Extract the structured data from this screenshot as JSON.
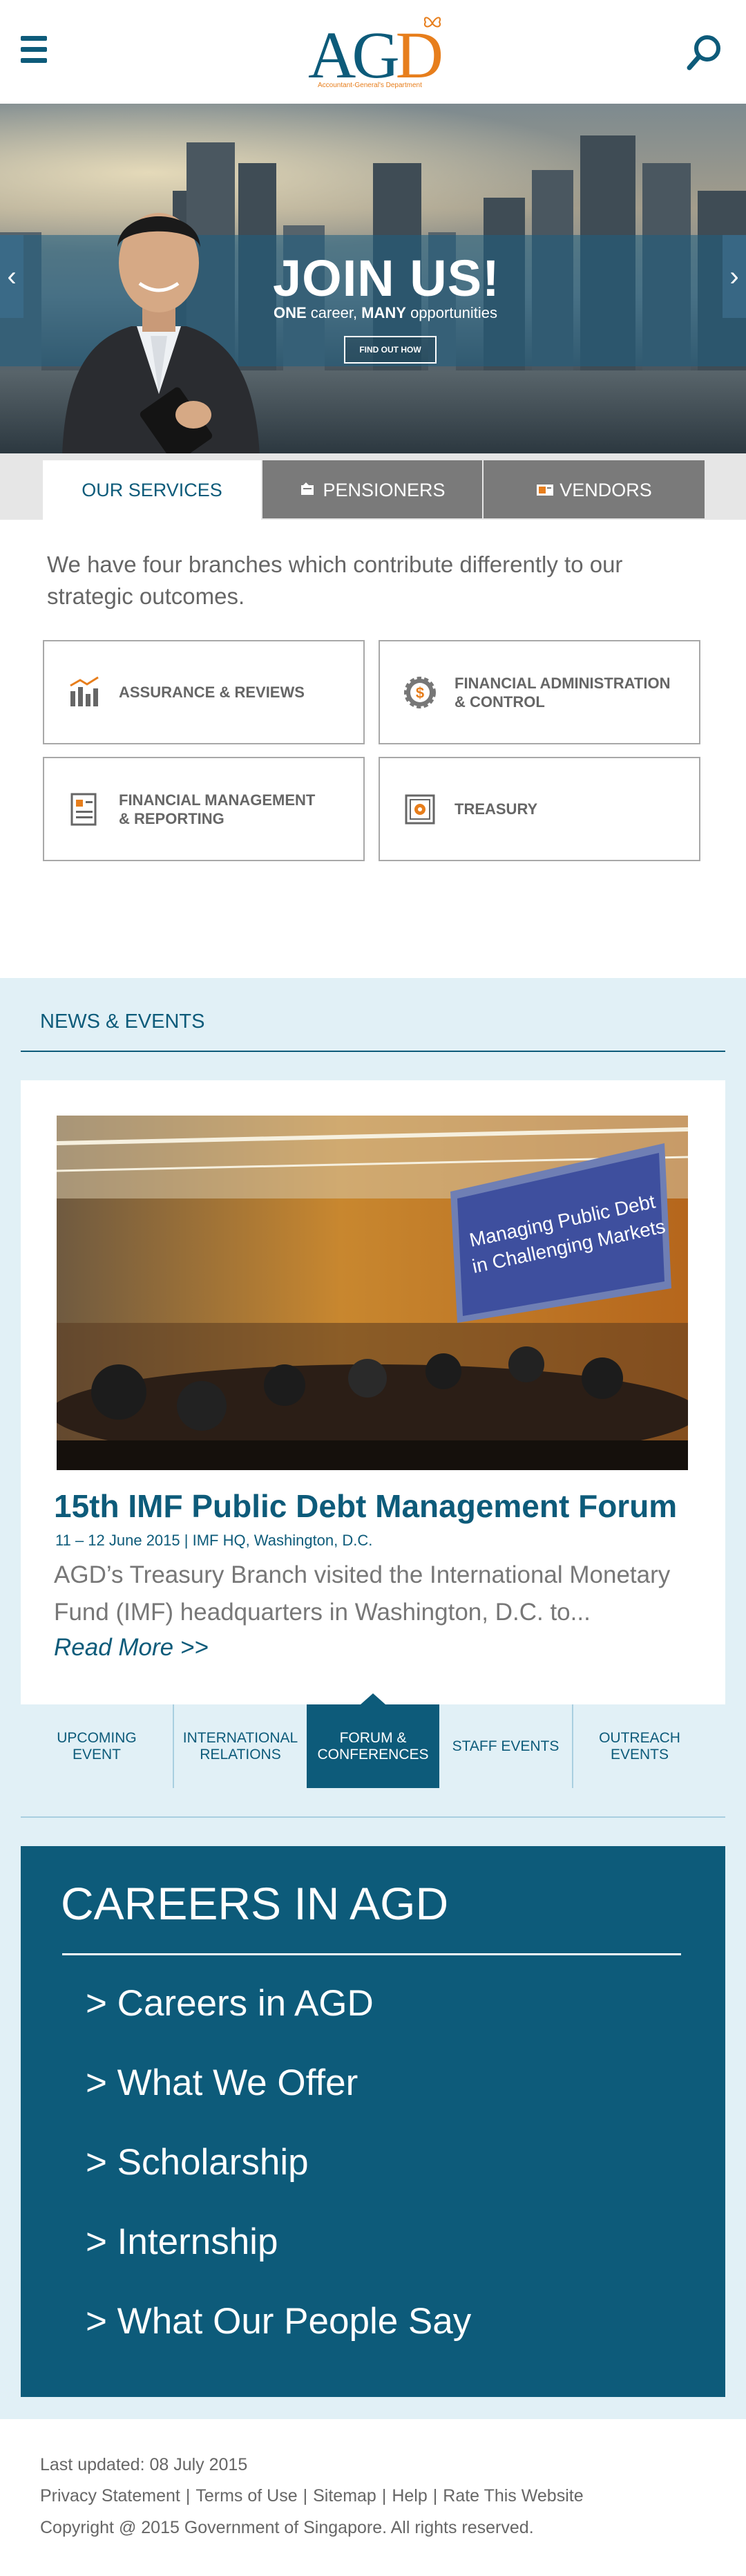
{
  "header": {
    "logo_text": "AGD",
    "logo_tagline": "Accountant-General's Department"
  },
  "hero": {
    "title": "JOIN US!",
    "subtitle_parts": [
      "ONE",
      " career, ",
      "MANY",
      " opportunities"
    ],
    "cta_label": "FIND OUT HOW",
    "prev_label": "‹",
    "next_label": "›"
  },
  "tabs": [
    {
      "label": "OUR SERVICES",
      "active": true
    },
    {
      "label": "PENSIONERS",
      "active": false
    },
    {
      "label": "VENDORS",
      "active": false
    }
  ],
  "services": {
    "intro": "We have four branches which contribute differently to our strategic outcomes.",
    "cards": [
      {
        "line1": "ASSURANCE & REVIEWS",
        "line2": "",
        "icon": "bar-chart-icon"
      },
      {
        "line1": "FINANCIAL ADMINISTRATION",
        "line2": "& CONTROL",
        "icon": "gear-dollar-icon"
      },
      {
        "line1": "FINANCIAL MANAGEMENT",
        "line2": "& REPORTING",
        "icon": "report-icon"
      },
      {
        "line1": "TREASURY",
        "line2": "",
        "icon": "safe-icon"
      }
    ]
  },
  "news": {
    "header": "NEWS & EVENTS",
    "photo_screen_text": [
      "Managing Public Debt",
      "in Challenging Markets"
    ],
    "title": "15th IMF Public Debt Management Forum",
    "meta": "11 – 12 June 2015 | IMF HQ, Washington, D.C.",
    "body": "AGD’s Treasury Branch visited the International Monetary Fund (IMF) headquarters in Washington, D.C. to...",
    "read_more": "Read More >>",
    "categories": [
      {
        "line1": "UPCOMING",
        "line2": "EVENT",
        "active": false
      },
      {
        "line1": "INTERNATIONAL",
        "line2": "RELATIONS",
        "active": false
      },
      {
        "line1": "FORUM &",
        "line2": "CONFERENCES",
        "active": true
      },
      {
        "line1": "STAFF EVENTS",
        "line2": "",
        "active": false
      },
      {
        "line1": "OUTREACH",
        "line2": "EVENTS",
        "active": false
      }
    ]
  },
  "careers": {
    "title": "CAREERS IN AGD",
    "links": [
      "> Careers in AGD",
      "> What We Offer",
      "> Scholarship",
      "> Internship",
      "> What Our People Say"
    ]
  },
  "footer": {
    "last_updated": "Last updated: 08 July 2015",
    "links": [
      "Privacy Statement",
      "Terms of Use",
      "Sitemap",
      "Help",
      "Rate This Website"
    ],
    "copyright": "Copyright @ 2015 Government of Singapore. All rights reserved."
  },
  "colors": {
    "brand_blue": "#0d5b7a",
    "brand_orange": "#e77e1c",
    "news_bg": "#e1f0f6",
    "tab_inactive": "#7a7a7a"
  }
}
